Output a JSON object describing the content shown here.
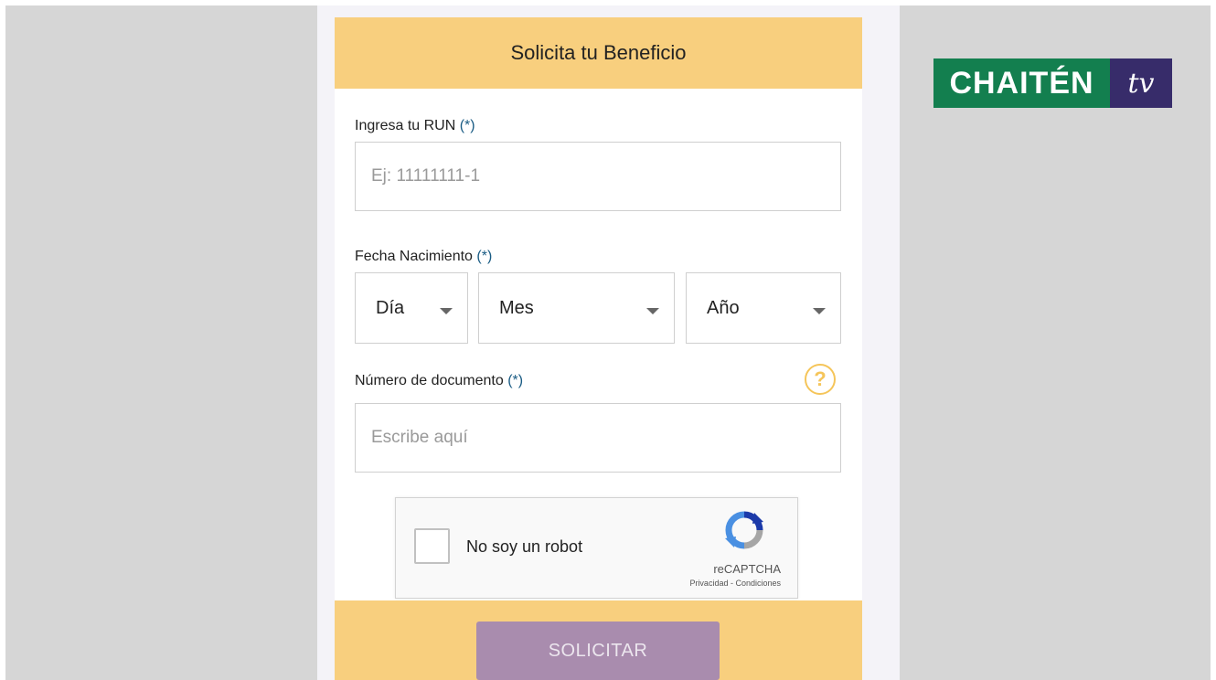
{
  "form": {
    "title": "Solicita tu Beneficio",
    "run": {
      "label": "Ingresa tu RUN",
      "required_mark": "(*)",
      "placeholder": "Ej: 11111111-1"
    },
    "birth_date": {
      "label": "Fecha Nacimiento",
      "required_mark": "(*)",
      "day": "Día",
      "month": "Mes",
      "year": "Año"
    },
    "document": {
      "label": "Número de documento",
      "required_mark": "(*)",
      "placeholder": "Escribe aquí",
      "help_icon": "?"
    },
    "captcha": {
      "label": "No soy un robot",
      "brand": "reCAPTCHA",
      "links": "Privacidad - Condiciones"
    },
    "submit_label": "SOLICITAR"
  },
  "logo": {
    "main": "CHAITÉN",
    "suffix": "tv"
  },
  "colors": {
    "header": "#f8cf7e",
    "submit": "#a98cae",
    "logo_green": "#137f4f",
    "logo_purple": "#372c6a",
    "help": "#f5c55a"
  }
}
